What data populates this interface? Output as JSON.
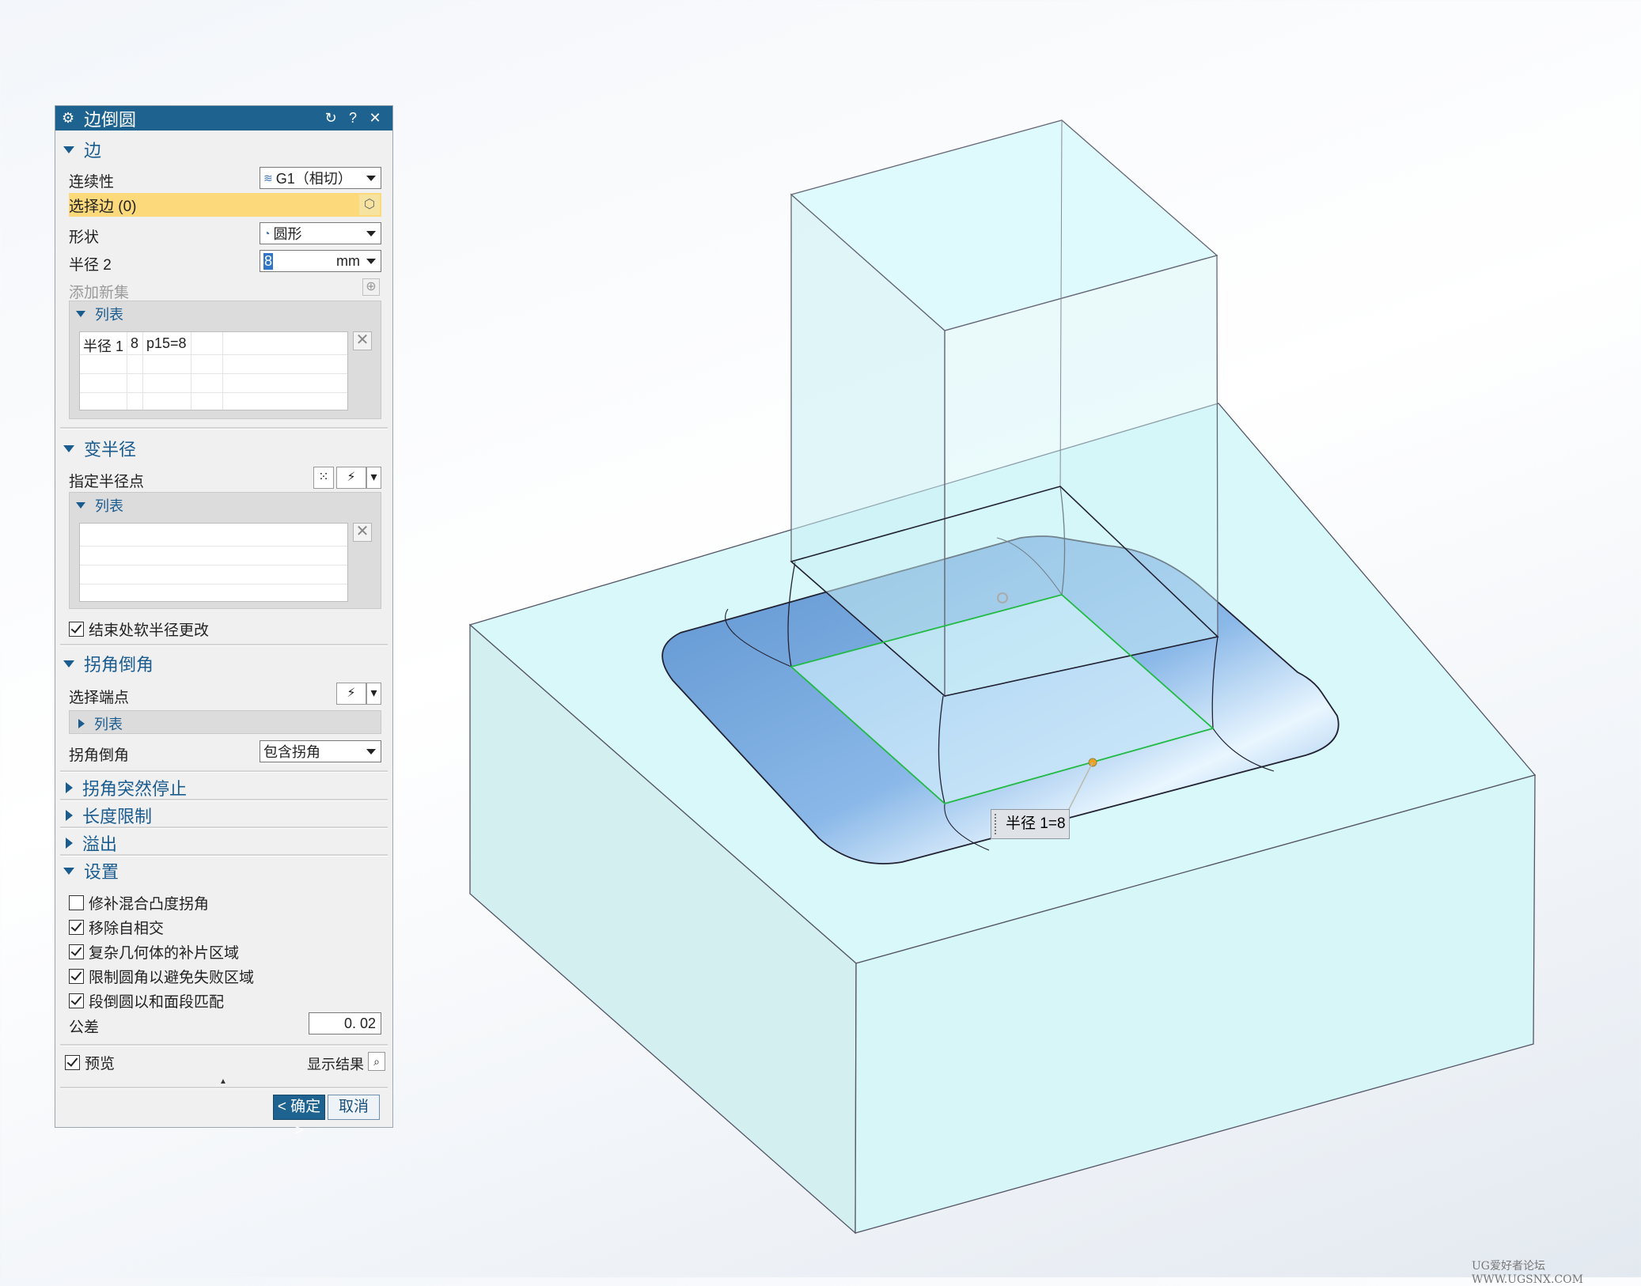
{
  "dialog": {
    "title": "边倒圆",
    "edge": {
      "header": "边",
      "continuity_label": "连续性",
      "continuity_value": "G1（相切）",
      "select_edge_label": "选择边 (0)",
      "shape_label": "形状",
      "shape_value": "圆形",
      "radius_label": "半径 2",
      "radius_value": "8",
      "radius_unit": "mm",
      "add_new_set_label": "添加新集",
      "list_header": "列表",
      "list_rows": [
        {
          "name": "半径 1",
          "value": "8",
          "expr": "p15=8"
        }
      ]
    },
    "variable_radius": {
      "header": "变半径",
      "specify_point_label": "指定半径点",
      "list_header": "列表",
      "soft_change_label": "结束处软半径更改",
      "soft_change_checked": true
    },
    "corner_setback": {
      "header": "拐角倒角",
      "select_endpoint_label": "选择端点",
      "list_header": "列表",
      "corner_label": "拐角倒角",
      "corner_value": "包含拐角"
    },
    "collapsed_sections": [
      "拐角突然停止",
      "长度限制",
      "溢出"
    ],
    "settings": {
      "header": "设置",
      "options": [
        {
          "label": "修补混合凸度拐角",
          "checked": false
        },
        {
          "label": "移除自相交",
          "checked": true
        },
        {
          "label": "复杂几何体的补片区域",
          "checked": true
        },
        {
          "label": "限制圆角以避免失败区域",
          "checked": true
        },
        {
          "label": "段倒圆以和面段匹配",
          "checked": true
        }
      ],
      "tolerance_label": "公差",
      "tolerance_value": "0. 02"
    },
    "preview_label": "预览",
    "preview_checked": true,
    "show_result_label": "显示结果",
    "ok_label": "< 确定 >",
    "cancel_label": "取消"
  },
  "viewport": {
    "radius_tooltip": "半径 1=8",
    "watermark": "UG爱好者论坛 WWW.UGSNX.COM",
    "colors": {
      "solid_fill": "#d7f6f7",
      "fillet_fill": "#7aace0",
      "edge_line": "#334455",
      "preview_line": "#22bb44"
    }
  }
}
